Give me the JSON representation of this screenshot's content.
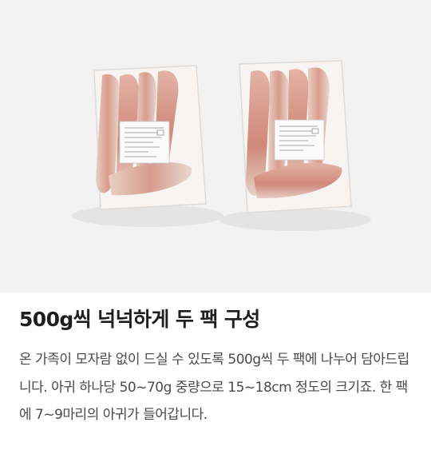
{
  "product": {
    "photo_icon": "packaged-fish-fillets-photo",
    "headline": "500g씩 넉넉하게 두 팩 구성",
    "description": "온 가족이 모자람 없이 드실 수 있도록 500g씩 두 팩에 나누어 담아드립니다. 아귀 하나당 50~70g 중량으로 15~18cm 정도의 크기죠. 한 팩에 7~9마리의 아귀가 들어갑니다."
  }
}
